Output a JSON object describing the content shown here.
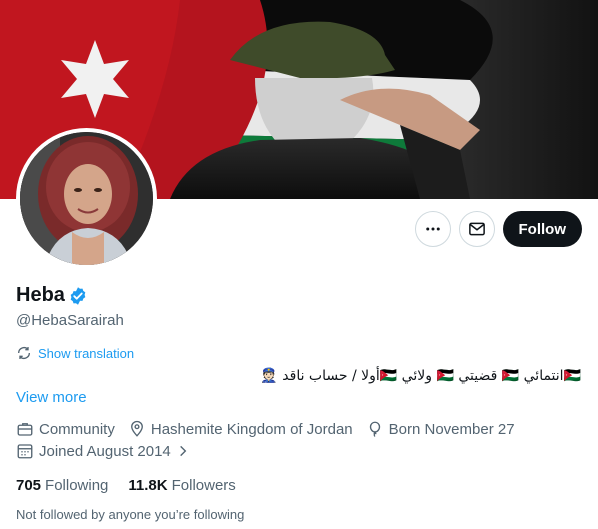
{
  "profile": {
    "name": "Heba",
    "handle": "@HebaSarairah",
    "follow_label": "Follow",
    "show_translation": "Show translation",
    "bio": "🇯🇴انتمائي 🇯🇴 قضيتي 🇯🇴 ولائي 🇯🇴أولا / حساب ناقد 👮🏻",
    "view_more": "View more",
    "category": "Community",
    "location": "Hashemite Kingdom of Jordan",
    "born": "Born November 27",
    "joined": "Joined August 2014",
    "following_count": "705",
    "following_label": "Following",
    "followers_count": "11.8K",
    "followers_label": "Followers",
    "not_followed": "Not followed by anyone you’re following"
  },
  "icons": {
    "more": "more-icon",
    "message": "mail-icon",
    "verified": "verified-badge-icon",
    "translate": "translate-icon",
    "category": "briefcase-icon",
    "location": "location-pin-icon",
    "born": "balloon-icon",
    "joined": "calendar-icon",
    "chevron": "chevron-right-icon"
  },
  "colors": {
    "accent": "#1d9bf0",
    "text": "#0f1419",
    "muted": "#536471",
    "follow_bg": "#0f1419"
  }
}
